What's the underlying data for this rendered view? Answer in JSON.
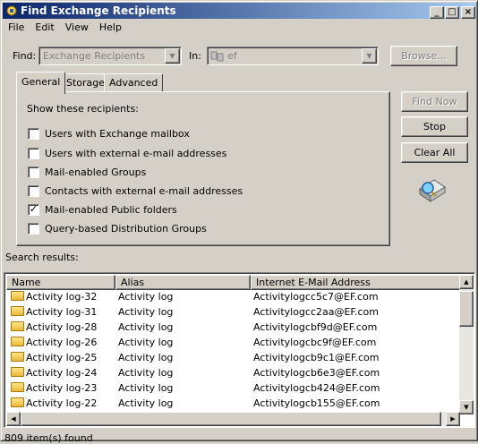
{
  "window": {
    "title": "Find Exchange Recipients",
    "minimize": "_",
    "maximize": "□",
    "close": "×"
  },
  "menu": [
    "File",
    "Edit",
    "View",
    "Help"
  ],
  "find": {
    "label": "Find:",
    "value": "Exchange Recipients",
    "in_label": "In:",
    "in_value": "ef",
    "browse_label": "Browse..."
  },
  "tabs": [
    "General",
    "Storage",
    "Advanced"
  ],
  "general": {
    "heading": "Show these recipients:",
    "options": [
      {
        "label": "Users with Exchange mailbox",
        "checked": false
      },
      {
        "label": "Users with external e-mail addresses",
        "checked": false
      },
      {
        "label": "Mail-enabled Groups",
        "checked": false
      },
      {
        "label": "Contacts with external e-mail addresses",
        "checked": false
      },
      {
        "label": "Mail-enabled Public folders",
        "checked": true
      },
      {
        "label": "Query-based Distribution Groups",
        "checked": false
      }
    ]
  },
  "buttons": {
    "find_now": "Find Now",
    "stop": "Stop",
    "clear_all": "Clear All"
  },
  "results": {
    "label": "Search results:",
    "columns": [
      "Name",
      "Alias",
      "Internet E-Mail Address"
    ],
    "rows": [
      {
        "name": "Activity log-32",
        "alias": "Activity log",
        "email": "Activitylogcc5c7@EF.com"
      },
      {
        "name": "Activity log-31",
        "alias": "Activity log",
        "email": "Activitylogcc2aa@EF.com"
      },
      {
        "name": "Activity log-28",
        "alias": "Activity log",
        "email": "Activitylogcbf9d@EF.com"
      },
      {
        "name": "Activity log-26",
        "alias": "Activity log",
        "email": "Activitylogcbc9f@EF.com"
      },
      {
        "name": "Activity log-25",
        "alias": "Activity log",
        "email": "Activitylogcb9c1@EF.com"
      },
      {
        "name": "Activity log-24",
        "alias": "Activity log",
        "email": "Activitylogcb6e3@EF.com"
      },
      {
        "name": "Activity log-23",
        "alias": "Activity log",
        "email": "Activitylogcb424@EF.com"
      },
      {
        "name": "Activity log-22",
        "alias": "Activity log",
        "email": "Activitylogcb155@EF.com"
      }
    ]
  },
  "status": "809 item(s) found"
}
